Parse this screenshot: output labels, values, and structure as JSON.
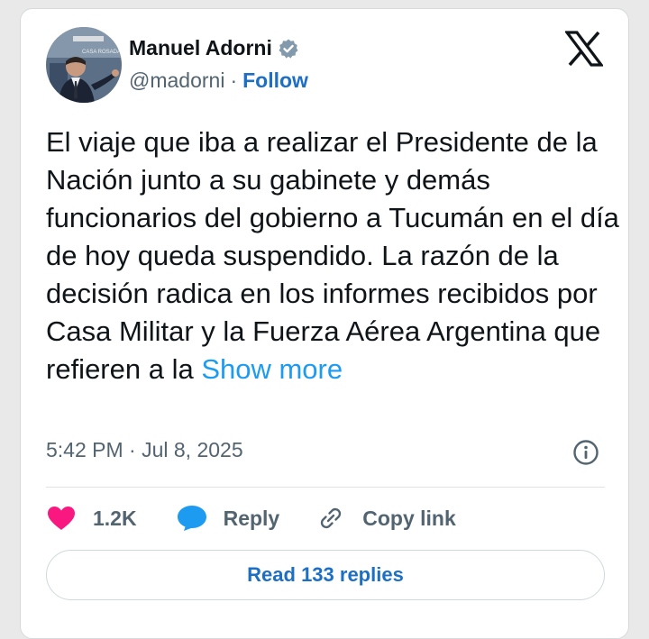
{
  "author": {
    "name": "Manuel Adorni",
    "handle": "@madorni",
    "separator": "·",
    "follow_label": "Follow",
    "avatar_caption": "CASA ROSADA"
  },
  "tweet": {
    "text": "El viaje que iba a realizar el Presidente de la Nación junto a su gabinete y demás funcionarios del gobierno a Tucumán en el día de hoy queda suspendido. La razón de la decisión radica en los informes recibidos por Casa Militar y la Fuerza Aérea Argentina que refieren a la ",
    "show_more_label": "Show more",
    "timestamp": "5:42 PM · Jul 8, 2025"
  },
  "actions": {
    "like_count": "1.2K",
    "reply_label": "Reply",
    "copy_link_label": "Copy link"
  },
  "read_replies_label": "Read 133 replies",
  "icons": {
    "logo": "x-logo-icon",
    "verified": "verified-badge-icon",
    "info": "info-icon",
    "like": "heart-icon",
    "reply": "reply-bubble-icon",
    "copy_link": "link-icon"
  },
  "colors": {
    "link": "#1d9bf0",
    "follow": "#1d6fc4",
    "heart": "#f91880",
    "reply_bubble": "#1d9bf0",
    "muted": "#536471"
  }
}
